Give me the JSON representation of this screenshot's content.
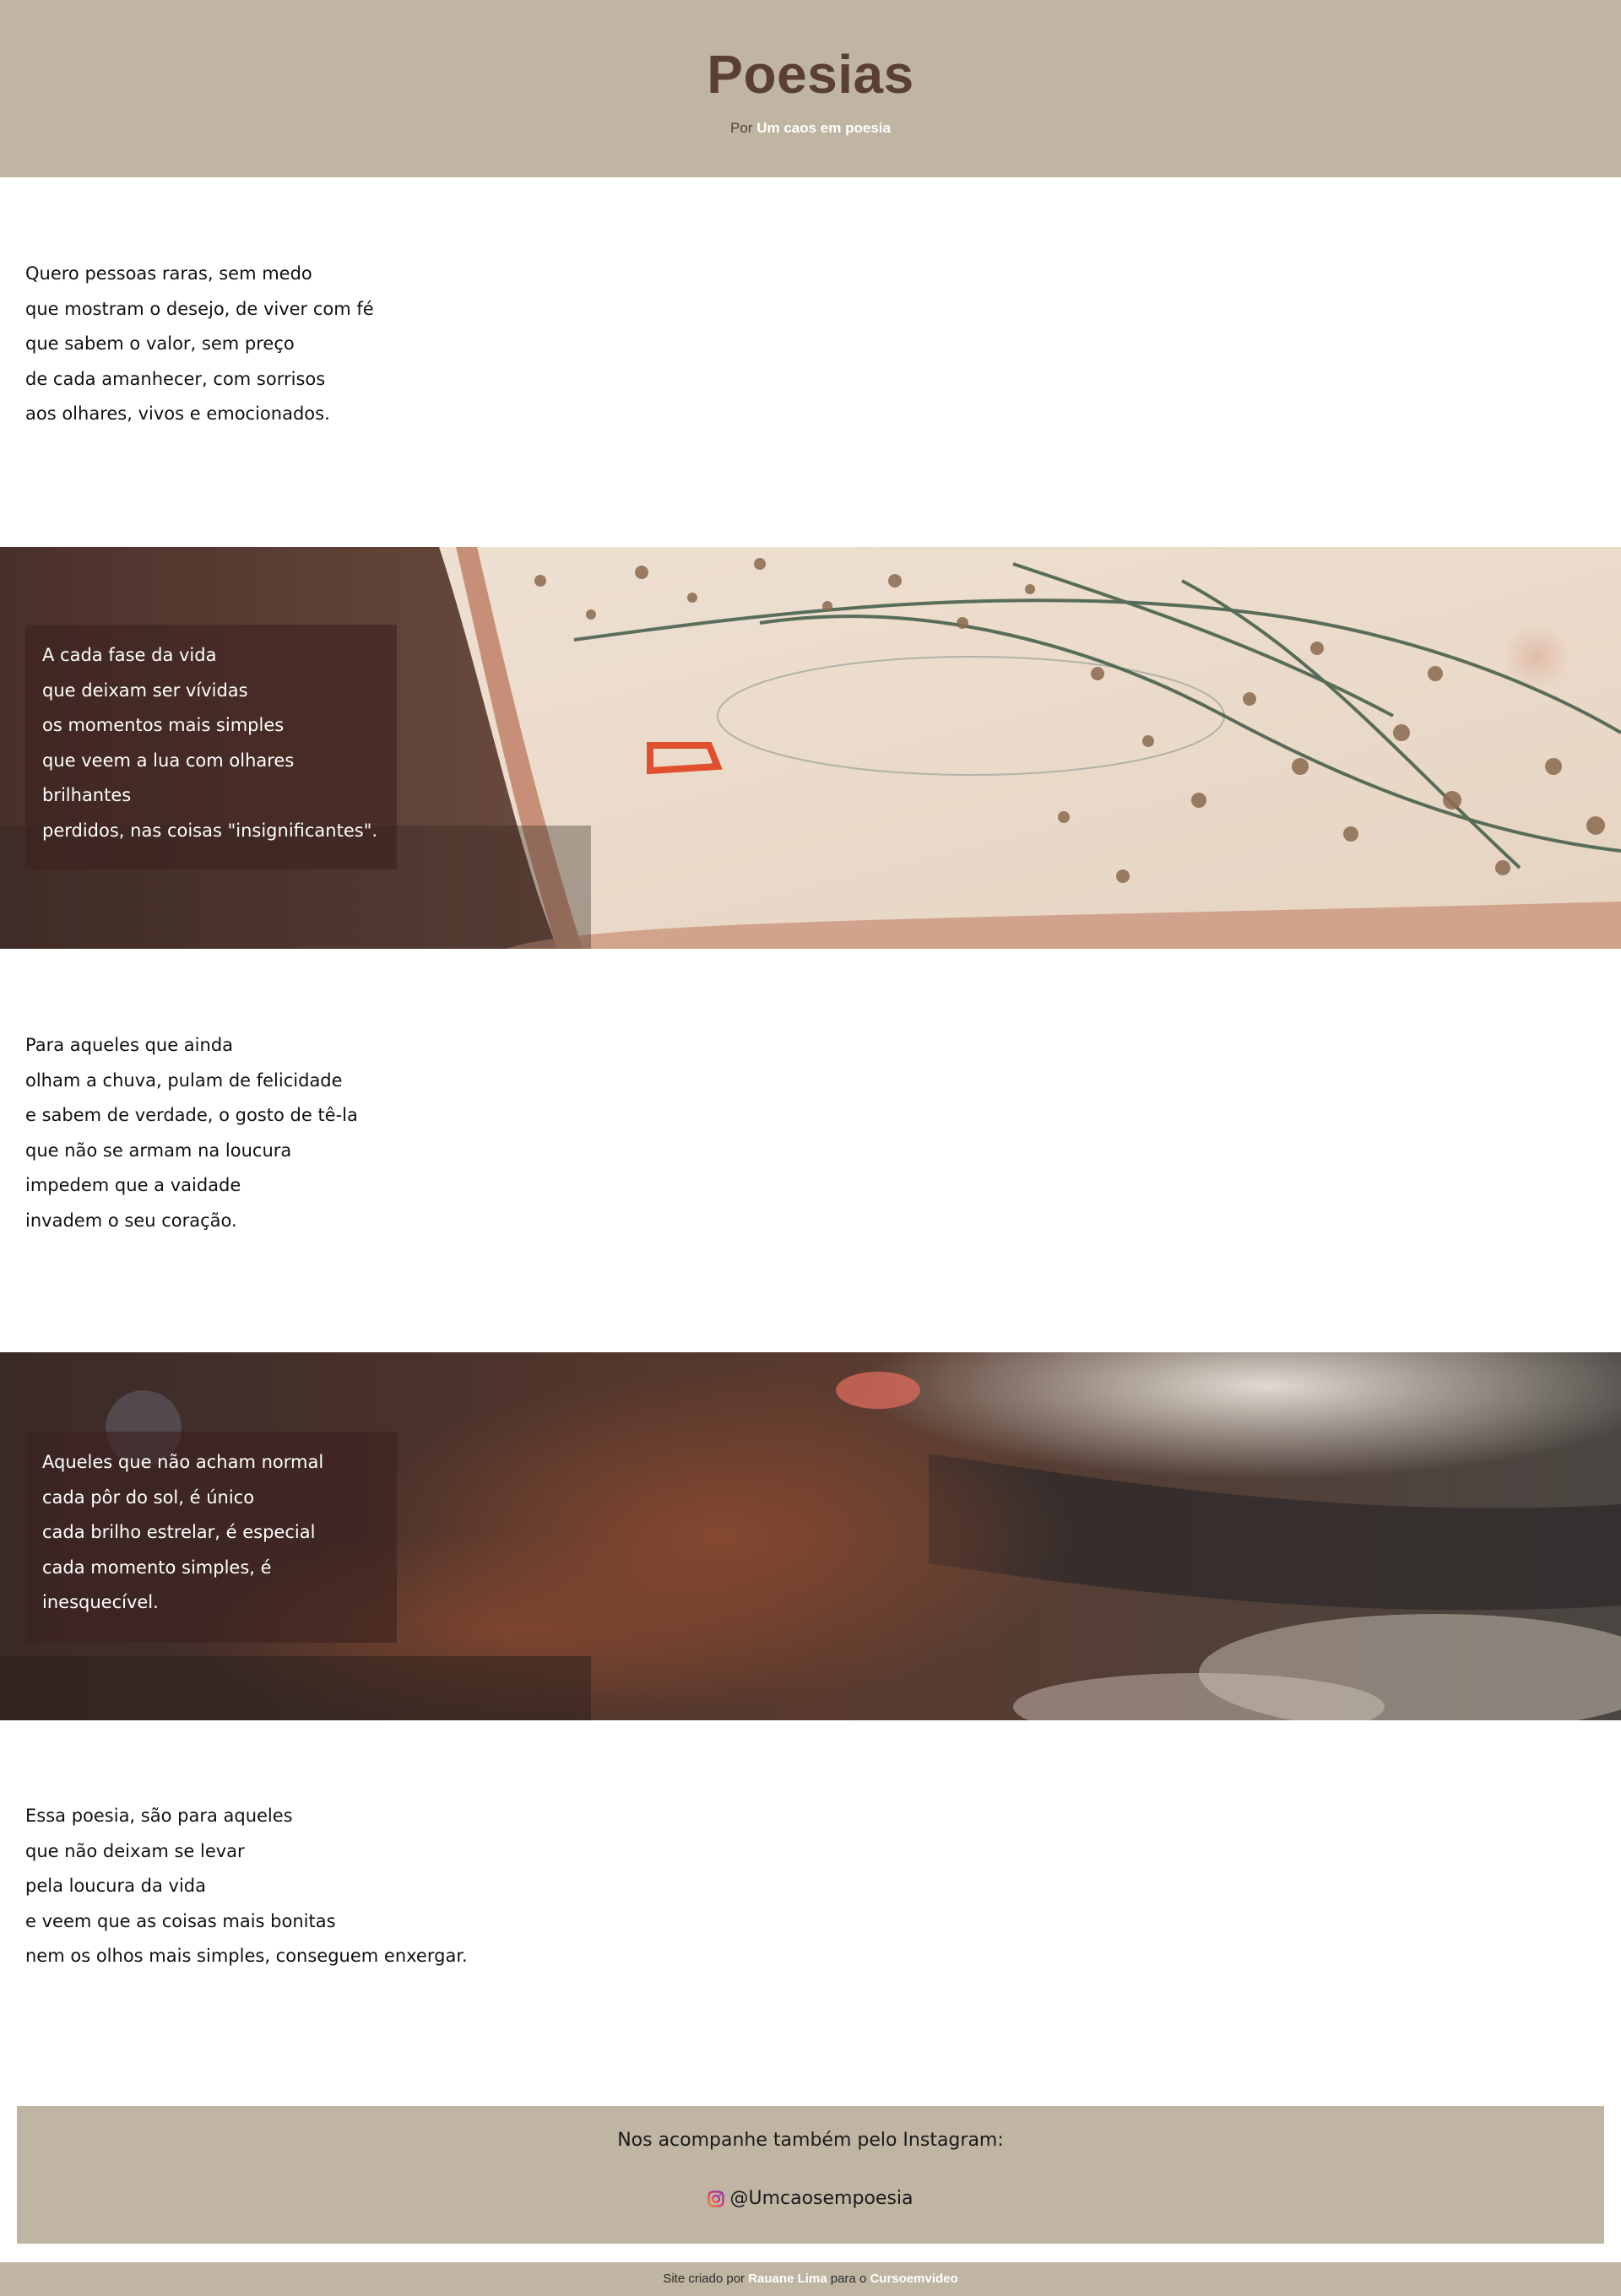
{
  "header": {
    "title": "Poesias",
    "by_prefix": "Por",
    "author": "Um caos em poesia"
  },
  "poem1": [
    "Quero pessoas raras, sem medo",
    "que mostram o desejo, de viver com fé",
    "que sabem o valor, sem preço",
    "de cada amanhecer, com sorrisos",
    "aos olhares, vivos e emocionados."
  ],
  "banner1": [
    "A cada fase da vida",
    "que deixam ser vívidas",
    "os momentos mais simples",
    "que veem a lua com olhares",
    "brilhantes",
    "perdidos, nas coisas \"insignificantes\"."
  ],
  "poem2": [
    "Para aqueles que ainda",
    "olham a chuva, pulam de felicidade",
    "e sabem de verdade, o gosto de tê-la",
    "que não se armam na loucura",
    "impedem que a vaidade",
    "invadem o seu coração."
  ],
  "banner2": [
    "Aqueles que não acham normal",
    "cada pôr do sol, é único",
    "cada brilho estrelar, é especial",
    "cada momento simples, é",
    "inesquecível."
  ],
  "poem3": [
    "Essa poesia, são para aqueles",
    "que não deixam se levar",
    "pela loucura da vida",
    "e veem que as coisas mais bonitas",
    "nem os olhos mais simples, conseguem enxergar."
  ],
  "footer": {
    "follow_text": "Nos acompanhe também pelo Instagram:",
    "instagram_handle": "@Umcaosempoesia",
    "instagram_icon": "instagram-icon",
    "credit_prefix": "Site criado por",
    "credit_author": "Rauane Lima",
    "credit_mid": "para o",
    "credit_site": "Cursoemvideo"
  },
  "colors": {
    "header_bg": "#bfb5a2",
    "title": "#5a3f37",
    "overlay_box": "#3c221e"
  }
}
